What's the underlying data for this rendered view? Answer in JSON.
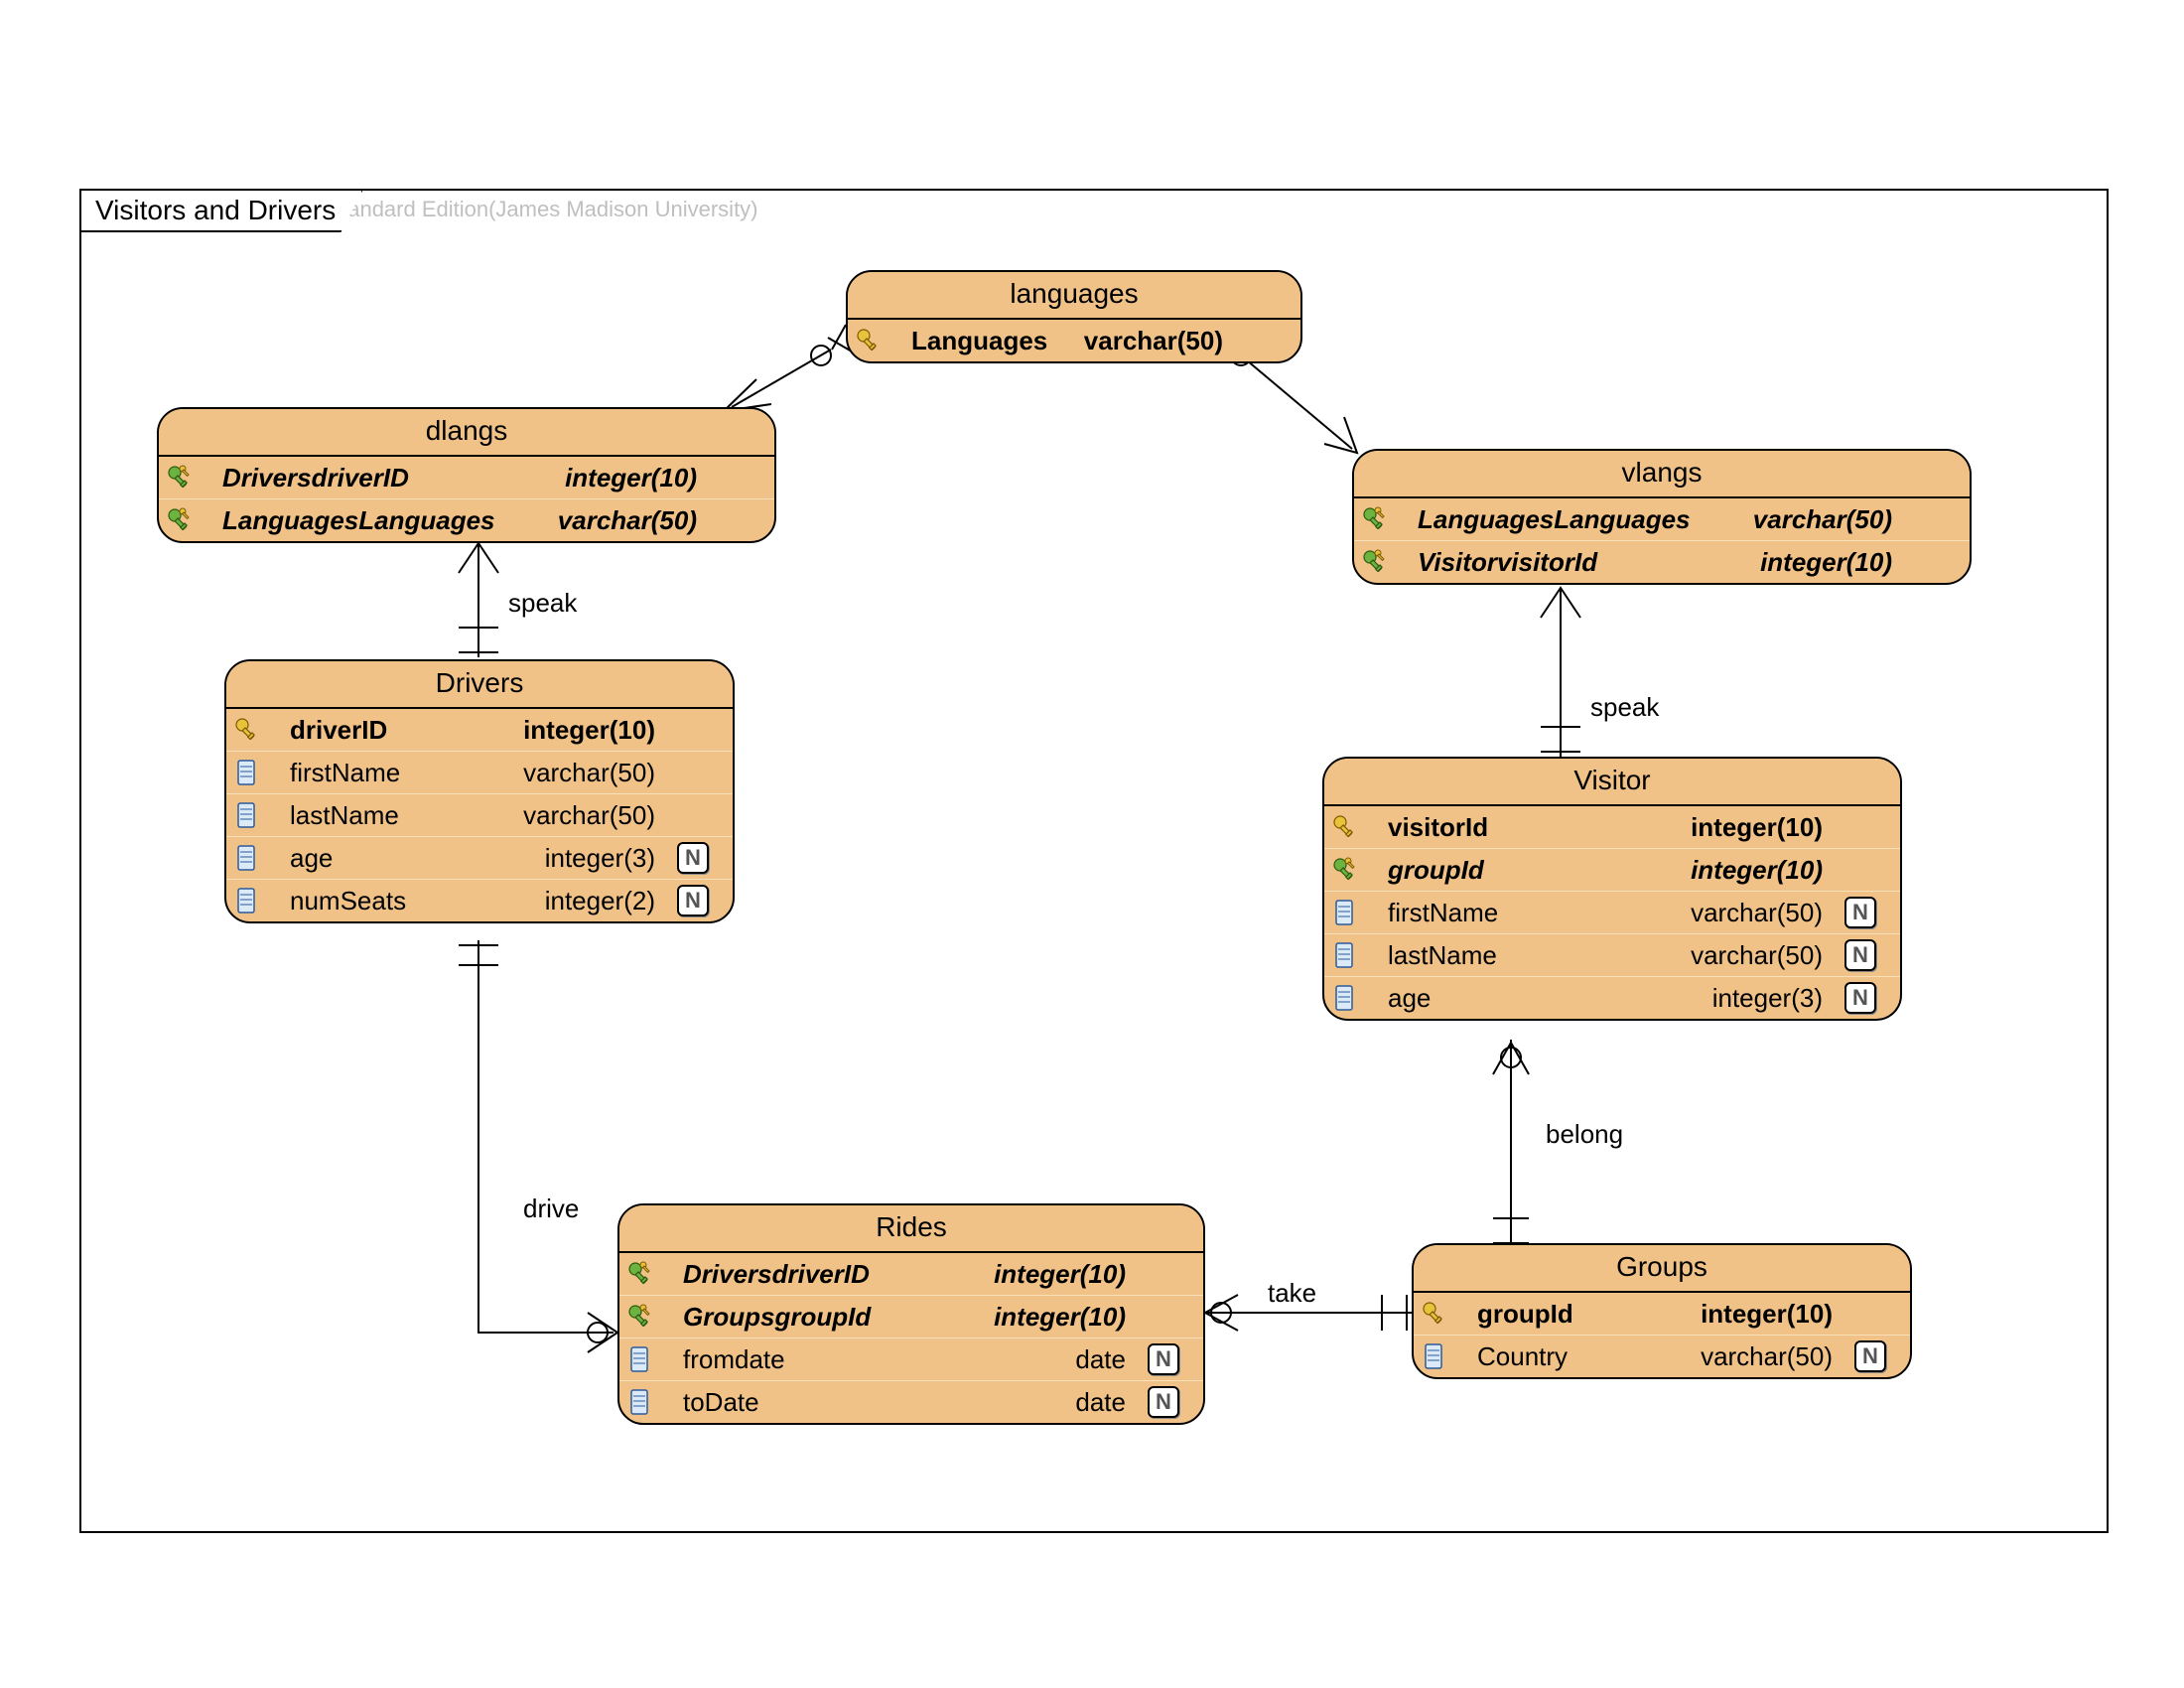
{
  "watermark": "Visual Paradigm for UML Standard Edition(James Madison University)",
  "frame_title": "Visitors and Drivers",
  "null_badge": "N",
  "labels": {
    "speak1": "speak",
    "speak2": "speak",
    "drive": "drive",
    "take": "take",
    "belong": "belong"
  },
  "entities": {
    "languages": {
      "title": "languages",
      "rows": [
        {
          "icon": "pk",
          "name": "Languages",
          "type": "varchar(50)",
          "pk": true
        }
      ]
    },
    "dlangs": {
      "title": "dlangs",
      "rows": [
        {
          "icon": "fk",
          "name": "DriversdriverID",
          "type": "integer(10)",
          "fk": true
        },
        {
          "icon": "fk",
          "name": "LanguagesLanguages",
          "type": "varchar(50)",
          "fk": true
        }
      ]
    },
    "vlangs": {
      "title": "vlangs",
      "rows": [
        {
          "icon": "fk",
          "name": "LanguagesLanguages",
          "type": "varchar(50)",
          "fk": true
        },
        {
          "icon": "fk",
          "name": "VisitorvisitorId",
          "type": "integer(10)",
          "fk": true
        }
      ]
    },
    "drivers": {
      "title": "Drivers",
      "rows": [
        {
          "icon": "pk",
          "name": "driverID",
          "type": "integer(10)",
          "pk": true
        },
        {
          "icon": "col",
          "name": "firstName",
          "type": "varchar(50)"
        },
        {
          "icon": "col",
          "name": "lastName",
          "type": "varchar(50)"
        },
        {
          "icon": "col",
          "name": "age",
          "type": "integer(3)",
          "nullable": true
        },
        {
          "icon": "col",
          "name": "numSeats",
          "type": "integer(2)",
          "nullable": true
        }
      ]
    },
    "visitor": {
      "title": "Visitor",
      "rows": [
        {
          "icon": "pk",
          "name": "visitorId",
          "type": "integer(10)",
          "pk": true
        },
        {
          "icon": "fk",
          "name": "groupId",
          "type": "integer(10)",
          "fk": true
        },
        {
          "icon": "col",
          "name": "firstName",
          "type": "varchar(50)",
          "nullable": true
        },
        {
          "icon": "col",
          "name": "lastName",
          "type": "varchar(50)",
          "nullable": true
        },
        {
          "icon": "col",
          "name": "age",
          "type": "integer(3)",
          "nullable": true
        }
      ]
    },
    "rides": {
      "title": "Rides",
      "rows": [
        {
          "icon": "fk",
          "name": "DriversdriverID",
          "type": "integer(10)",
          "fk": true
        },
        {
          "icon": "fk",
          "name": "GroupsgroupId",
          "type": "integer(10)",
          "fk": true
        },
        {
          "icon": "col",
          "name": "fromdate",
          "type": "date",
          "nullable": true
        },
        {
          "icon": "col",
          "name": "toDate",
          "type": "date",
          "nullable": true
        }
      ]
    },
    "groups": {
      "title": "Groups",
      "rows": [
        {
          "icon": "pk",
          "name": "groupId",
          "type": "integer(10)",
          "pk": true
        },
        {
          "icon": "col",
          "name": "Country",
          "type": "varchar(50)",
          "nullable": true
        }
      ]
    }
  }
}
